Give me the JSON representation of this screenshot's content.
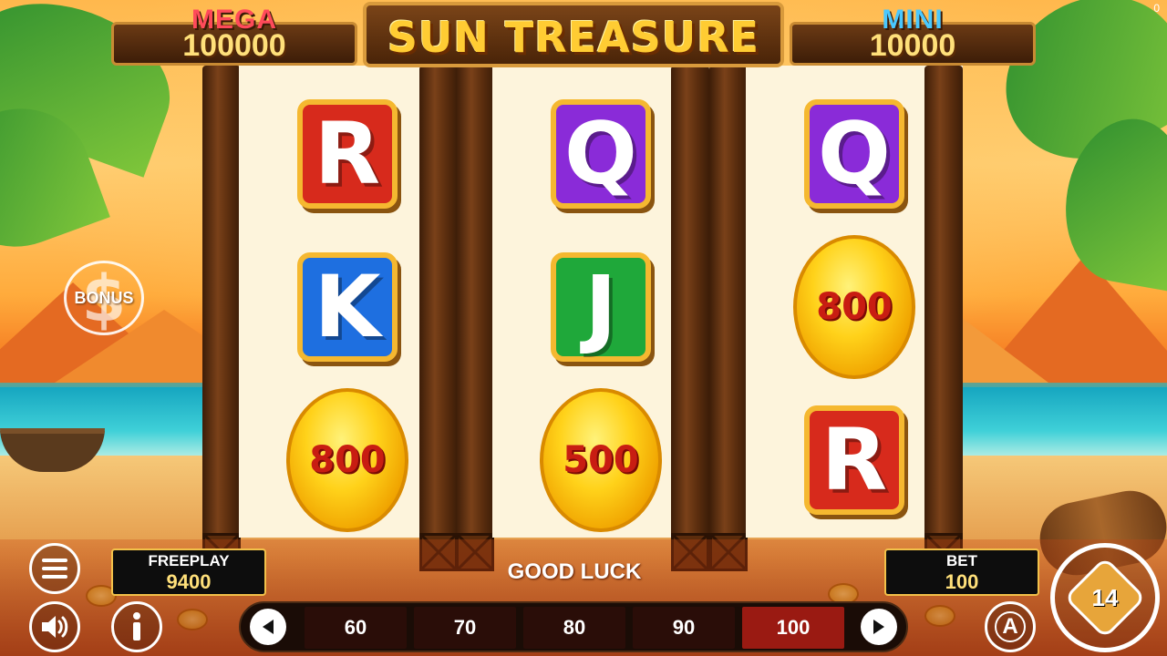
{
  "title": "SUN TREASURE",
  "corner_counter": "0",
  "jackpots": [
    {
      "label": "MEGA",
      "value": "100000",
      "color": "#ff4a5a"
    },
    {
      "label": "MINI",
      "value": "10000",
      "color": "#49c8ff"
    }
  ],
  "reels": [
    [
      {
        "kind": "letter",
        "text": "R",
        "color": "#d72a1c"
      },
      {
        "kind": "letter",
        "text": "K",
        "color": "#1e6fe0"
      },
      {
        "kind": "coin",
        "text": "800"
      }
    ],
    [
      {
        "kind": "letter",
        "text": "Q",
        "color": "#8a2bd8"
      },
      {
        "kind": "letter",
        "text": "J",
        "color": "#1fa83a"
      },
      {
        "kind": "coin",
        "text": "500"
      }
    ],
    [
      {
        "kind": "letter",
        "text": "Q",
        "color": "#8a2bd8"
      },
      {
        "kind": "coin",
        "text": "800"
      },
      {
        "kind": "letter",
        "text": "R",
        "color": "#d72a1c"
      }
    ]
  ],
  "bonus_label": "BONUS",
  "freeplay": {
    "label": "FREEPLAY",
    "value": "9400"
  },
  "bet": {
    "label": "BET",
    "value": "100"
  },
  "message": "GOOD LUCK",
  "bet_options": [
    "60",
    "70",
    "80",
    "90",
    "100"
  ],
  "selected_bet_index": 4,
  "autoplay_label": "A",
  "spin_counter": "14",
  "icons": {
    "menu": "hamburger-menu-icon",
    "sound": "speaker-icon",
    "info": "info-icon",
    "left": "arrow-left-icon",
    "right": "arrow-right-icon"
  }
}
